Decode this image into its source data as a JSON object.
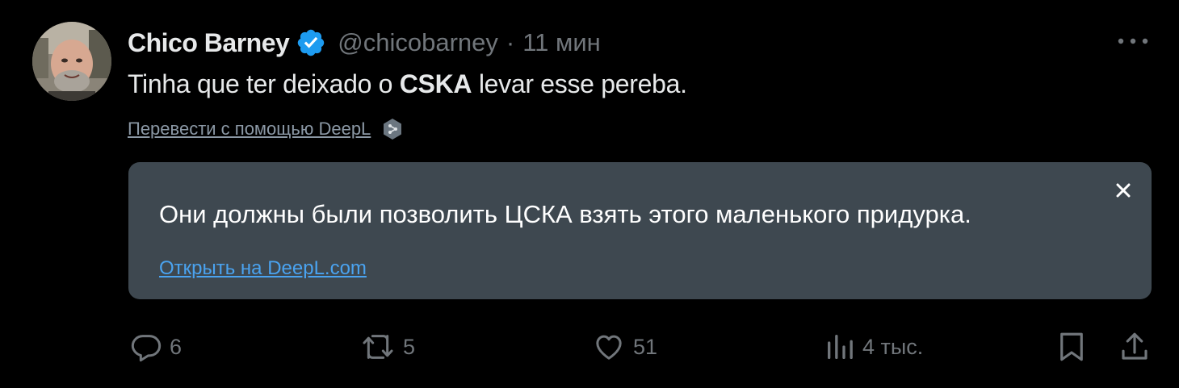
{
  "tweet": {
    "author": {
      "display_name": "Chico Barney",
      "handle": "@chicobarney",
      "verified": true,
      "avatar_icon": "user-avatar"
    },
    "separator": "·",
    "time": "11 мин",
    "text_before": "Tinha que ter deixado o ",
    "text_bold": "CSKA",
    "text_after": " levar esse pereba.",
    "more_icon": "more-horizontal-icon"
  },
  "translate": {
    "link_label": "Перевести с помощью DeepL",
    "icon": "deepl-icon"
  },
  "translation_box": {
    "text": "Они должны были позволить ЦСКА взять этого маленького придурка.",
    "open_link_label": "Открыть на DeepL.com",
    "close_icon": "close-icon",
    "background": "#3e4850",
    "link_color": "#4aa3f0"
  },
  "actions": {
    "reply": {
      "icon": "reply-icon",
      "count": "6"
    },
    "repost": {
      "icon": "repost-icon",
      "count": "5"
    },
    "like": {
      "icon": "heart-icon",
      "count": "51"
    },
    "views": {
      "icon": "views-chart-icon",
      "count": "4 тыс."
    },
    "bookmark": {
      "icon": "bookmark-icon"
    },
    "share": {
      "icon": "share-icon"
    }
  },
  "colors": {
    "background": "#000000",
    "primary_text": "#e7e9ea",
    "secondary_text": "#71767b",
    "verified_badge": "#1d9bf0"
  }
}
